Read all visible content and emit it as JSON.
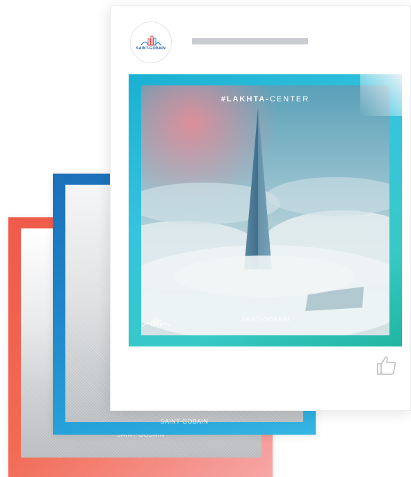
{
  "brand": {
    "name": "SAINT-GOBAIN"
  },
  "post": {
    "hashtag_bold": "#LAKHTA-",
    "hashtag_light": "CENTER",
    "photo_logo_text": "SAINT-GOBAIN",
    "like_icon": "thumbs-up-icon"
  },
  "stacked_cards": [
    {
      "frame_color": "#1f86c9",
      "logo_text": "SAINT-GOBAIN"
    },
    {
      "frame_color": "#f05a4a",
      "logo_text": "SAINT-GOBAIN"
    }
  ],
  "colors": {
    "frame_teal": "#1ab0d2",
    "frame_blue": "#1f86c9",
    "frame_red": "#f05a4a",
    "placeholder_gray": "#c9ccd0",
    "brand_blue": "#1f5fa8"
  }
}
